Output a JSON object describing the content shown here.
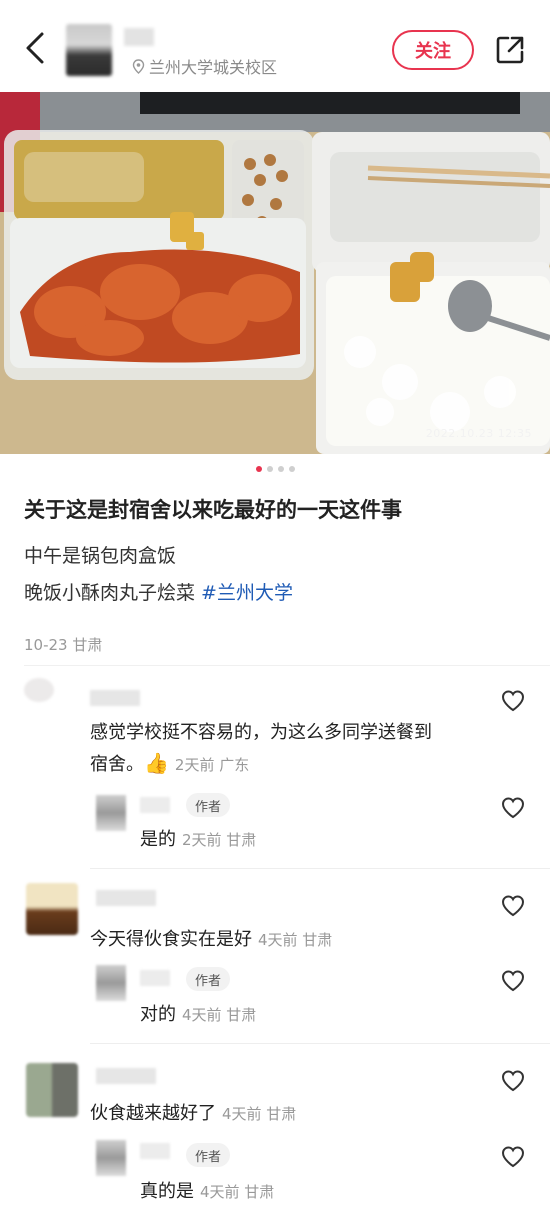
{
  "header": {
    "location": "兰州大学城关校区",
    "follow_label": "关注"
  },
  "photo": {
    "timestamp": "2022.10.23 12:35",
    "dots": 4,
    "active_dot": 1
  },
  "post": {
    "title": "关于这是封宿舍以来吃最好的一天这件事",
    "line1": "中午是锅包肉盒饭",
    "line2_text": "晚饭小酥肉丸子烩菜 ",
    "line2_tag": "#兰州大学",
    "meta": "10-23 甘肃"
  },
  "comments": [
    {
      "text_line1": "感觉学校挺不容易的，为这么多同学送餐到",
      "text_line2": "宿舍。",
      "emoji": "👍",
      "time": "2天前 广东",
      "reply": {
        "tag": "作者",
        "text": "是的",
        "time": "2天前 甘肃"
      }
    },
    {
      "text": "今天得伙食实在是好",
      "time": "4天前 甘肃",
      "reply": {
        "tag": "作者",
        "text": "对的",
        "time": "4天前 甘肃"
      }
    },
    {
      "text": "伙食越来越好了",
      "time": "4天前 甘肃",
      "reply": {
        "tag": "作者",
        "text": "真的是",
        "time": "4天前 甘肃"
      }
    }
  ],
  "colors": {
    "accent": "#e8344f",
    "hashtag": "#1f5bb5",
    "muted": "#999999"
  }
}
